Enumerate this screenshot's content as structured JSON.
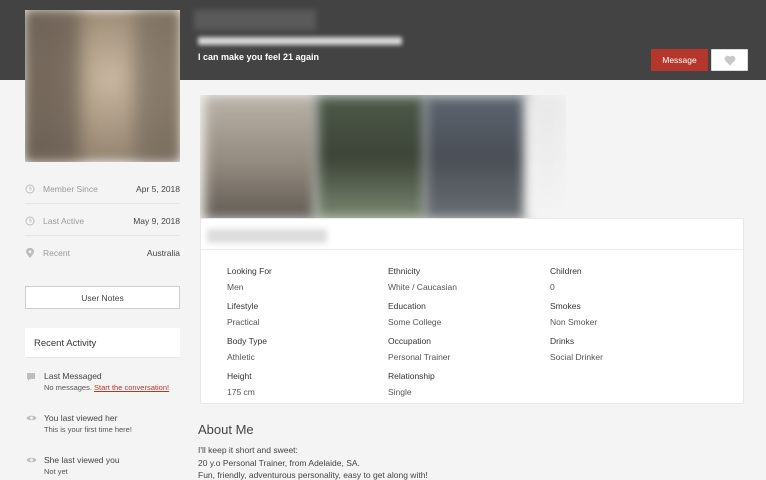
{
  "header": {
    "tagline": "I can make you feel 21 again",
    "message_button": "Message",
    "favorite_icon": "heart-icon"
  },
  "sidebar": {
    "stats": [
      {
        "icon": "clock-icon",
        "label": "Member Since",
        "value": "Apr 5, 2018"
      },
      {
        "icon": "clock-icon",
        "label": "Last Active",
        "value": "May 9, 2018"
      },
      {
        "icon": "location-pin-icon",
        "label": "Recent",
        "value": "Australia"
      }
    ],
    "user_notes_button": "User Notes",
    "recent_activity_title": "Recent Activity",
    "activity": [
      {
        "icon": "chat-icon",
        "title": "Last Messaged",
        "sub": "No messages.",
        "link": "Start the conversation!"
      },
      {
        "icon": "eye-icon",
        "title": "You last viewed her",
        "sub": "This is your first time here!"
      },
      {
        "icon": "eye-icon",
        "title": "She last viewed you",
        "sub": "Not yet"
      }
    ]
  },
  "info": {
    "fields": [
      {
        "key": "Looking For",
        "value": "Men"
      },
      {
        "key": "Ethnicity",
        "value": "White / Caucasian"
      },
      {
        "key": "Children",
        "value": "0"
      },
      {
        "key": "Lifestyle",
        "value": "Practical"
      },
      {
        "key": "Education",
        "value": "Some College"
      },
      {
        "key": "Smokes",
        "value": "Non Smoker"
      },
      {
        "key": "Body Type",
        "value": "Athletic"
      },
      {
        "key": "Occupation",
        "value": "Personal Trainer"
      },
      {
        "key": "Drinks",
        "value": "Social Drinker"
      },
      {
        "key": "Height",
        "value": "175 cm"
      },
      {
        "key": "Relationship",
        "value": "Single"
      }
    ]
  },
  "about": {
    "title": "About Me",
    "lines": [
      "I'll keep it short and sweet:",
      "20 y.o Personal Trainer, from Adelaide, SA.",
      "Fun, friendly, adventurous personality, easy to get along with!"
    ]
  },
  "colors": {
    "header_bg": "#434343",
    "accent": "#b5372b",
    "page_bg": "#f4f4f4"
  }
}
